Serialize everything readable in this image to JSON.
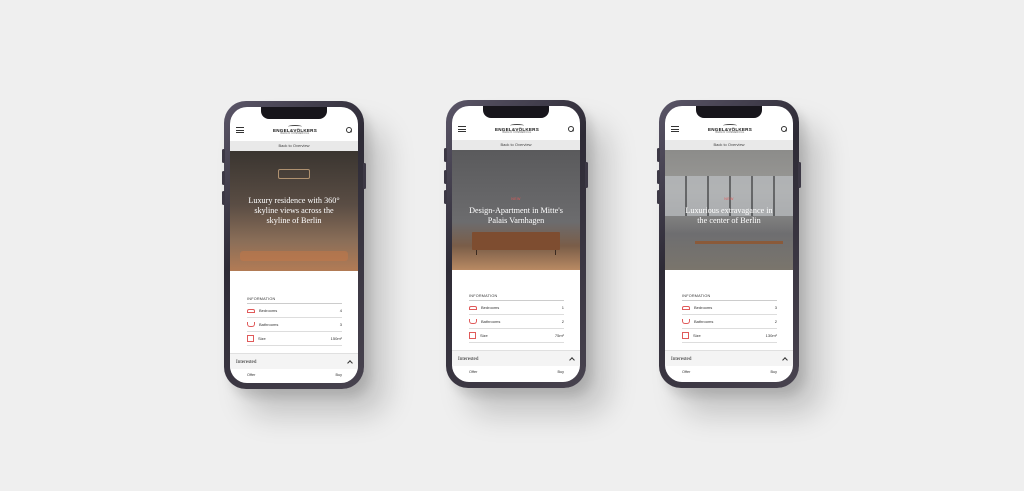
{
  "brand": {
    "name": "ENGEL&VÖLKERS",
    "sub": "BERLIN COMMERCIAL"
  },
  "phones": [
    {
      "back_label": "Back to Overview",
      "hero_tag": "",
      "hero_title": "Luxury residence with 360° skyline views across the skyline of Berlin",
      "info_title": "INFORMATION",
      "rows": [
        {
          "label": "Bedrooms",
          "value": "4",
          "icon": "bed-icon"
        },
        {
          "label": "Bathrooms",
          "value": "3",
          "icon": "bathtub-icon"
        },
        {
          "label": "Size",
          "value": "150m²",
          "icon": "size-icon"
        }
      ],
      "interested_label": "Interested",
      "offer_label": "Offer",
      "offer_value": "Buy"
    },
    {
      "back_label": "Back to Overview",
      "hero_tag": "NEW",
      "hero_title": "Design-Apartment in Mitte's Palais Varnhagen",
      "info_title": "INFORMATION",
      "rows": [
        {
          "label": "Bedrooms",
          "value": "1",
          "icon": "bed-icon"
        },
        {
          "label": "Bathrooms",
          "value": "2",
          "icon": "bathtub-icon"
        },
        {
          "label": "Size",
          "value": "75m²",
          "icon": "size-icon"
        }
      ],
      "interested_label": "Interested",
      "offer_label": "Offer",
      "offer_value": "Buy"
    },
    {
      "back_label": "Back to Overview",
      "hero_tag": "NEW",
      "hero_title": "Luxurious extravagance in the center of Berlin",
      "info_title": "INFORMATION",
      "rows": [
        {
          "label": "Bedrooms",
          "value": "3",
          "icon": "bed-icon"
        },
        {
          "label": "Bathrooms",
          "value": "2",
          "icon": "bathtub-icon"
        },
        {
          "label": "Size",
          "value": "130m²",
          "icon": "size-icon"
        }
      ],
      "interested_label": "Interested",
      "offer_label": "Offer",
      "offer_value": "Buy"
    }
  ]
}
